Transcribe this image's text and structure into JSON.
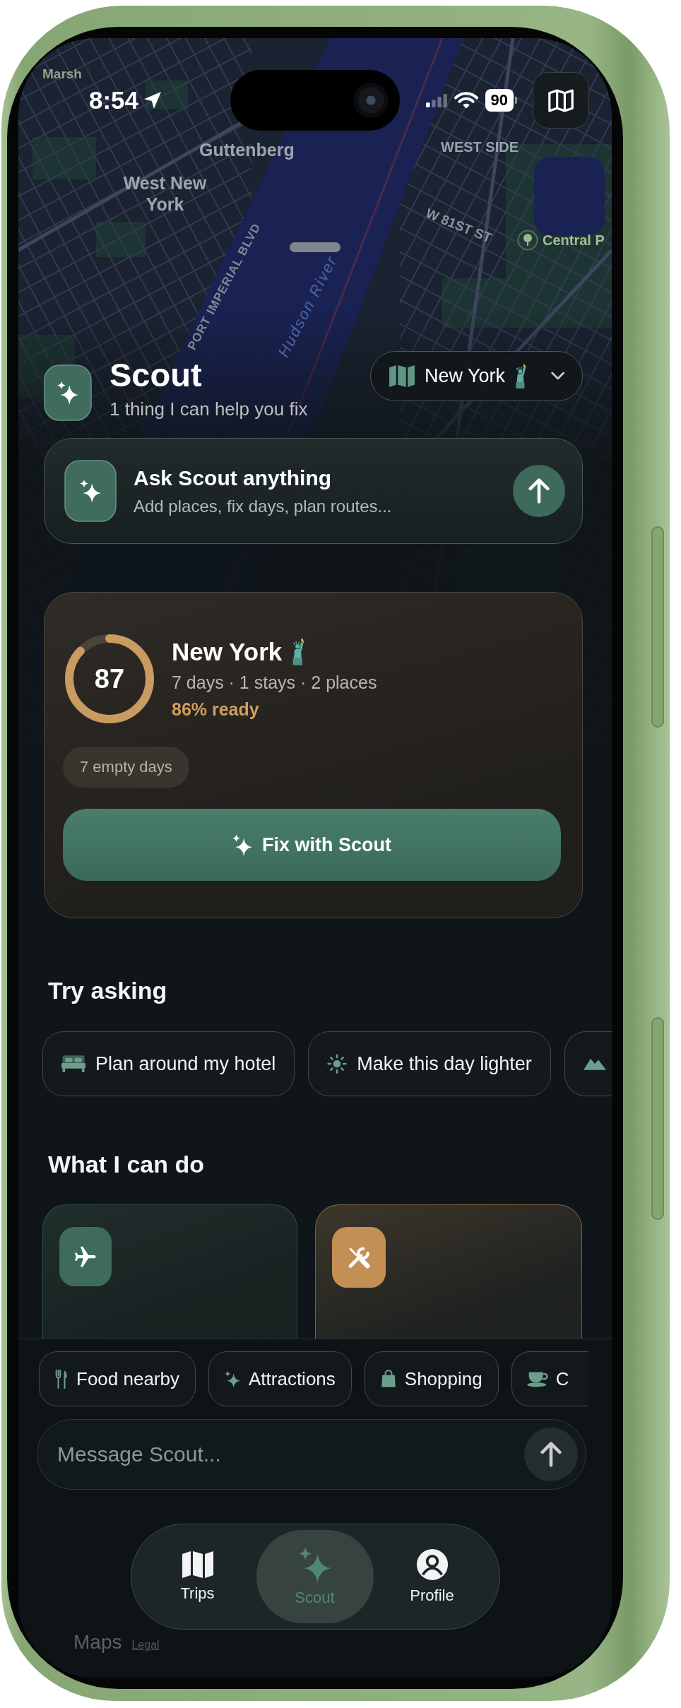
{
  "status_bar": {
    "time": "8:54",
    "battery": "90"
  },
  "map": {
    "labels": [
      {
        "text": "Marsh"
      },
      {
        "text": "WEST SIDE"
      },
      {
        "text": "Guttenberg"
      },
      {
        "text": "West New York"
      },
      {
        "text": "W 81ST ST"
      },
      {
        "text": "Central P"
      },
      {
        "text": "PORT IMPERIAL BLVD"
      },
      {
        "text": "Hudson River"
      }
    ],
    "attribution": "Maps",
    "legal": "Legal"
  },
  "header": {
    "title": "Scout",
    "subtitle": "1 thing I can help you fix",
    "city": "New York"
  },
  "ask_card": {
    "title": "Ask Scout anything",
    "subtitle": "Add places, fix days, plan routes..."
  },
  "trip_card": {
    "score": "87",
    "level": 0.87,
    "title": "New York",
    "meta": "7 days · 1 stays · 2 places",
    "readiness": "86% ready",
    "tag": "7 empty days",
    "action": "Fix with Scout"
  },
  "try_asking": {
    "heading": "Try asking",
    "suggestions": [
      {
        "label": "Plan around my hotel",
        "cut_off": false
      },
      {
        "label": "Make this day lighter",
        "cut_off": false
      },
      {
        "cut_off": true
      }
    ]
  },
  "capabilities": {
    "heading": "What I can do",
    "cards": [
      {
        "color": "#3e6b5c"
      },
      {
        "color": "#c48f55"
      }
    ]
  },
  "quick_actions": [
    {
      "label": "Food nearby",
      "cut_off": false
    },
    {
      "label": "Attractions",
      "cut_off": false
    },
    {
      "label": "Shopping",
      "cut_off": false
    },
    {
      "label": "C",
      "cut_off": true
    }
  ],
  "composer": {
    "placeholder": "Message Scout..."
  },
  "tab_bar": {
    "tabs": [
      {
        "label": "Trips",
        "selected": false
      },
      {
        "label": "Scout",
        "selected": true
      },
      {
        "label": "Profile",
        "selected": false
      }
    ]
  }
}
